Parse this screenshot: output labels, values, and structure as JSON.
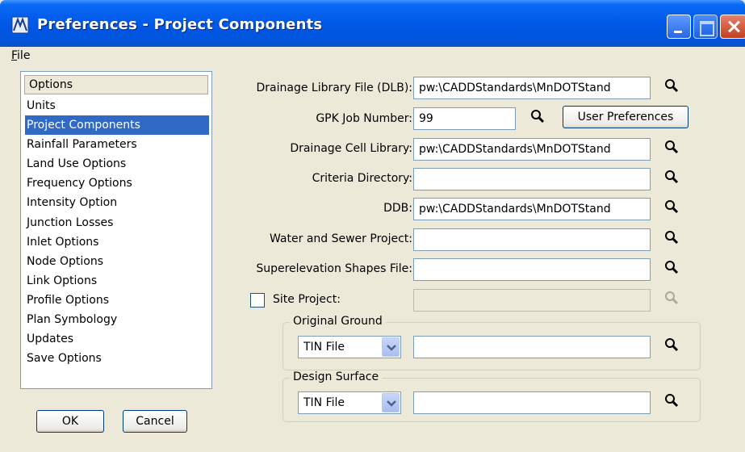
{
  "window": {
    "title": "Preferences - Project Components"
  },
  "menu": {
    "file_label": "File",
    "file_mnemonic": "F",
    "file_rest": "ile"
  },
  "options": {
    "header": "Options",
    "items": [
      "Units",
      "Project Components",
      "Rainfall Parameters",
      "Land Use Options",
      "Frequency Options",
      "Intensity Option",
      "Junction Losses",
      "Inlet Options",
      "Node Options",
      "Link Options",
      "Profile Options",
      "Plan Symbology",
      "Updates",
      "Save Options"
    ],
    "selected": "Project Components"
  },
  "buttons": {
    "ok": "OK",
    "cancel": "Cancel",
    "user_preferences": "User Preferences"
  },
  "form": {
    "drainage_library": {
      "label": "Drainage Library File (DLB):",
      "value": "pw:\\CADDStandards\\MnDOTStand"
    },
    "gpk_job": {
      "label": "GPK Job Number:",
      "value": "99"
    },
    "drainage_cell": {
      "label": "Drainage Cell Library:",
      "value": "pw:\\CADDStandards\\MnDOTStand"
    },
    "criteria_dir": {
      "label": "Criteria Directory:",
      "value": ""
    },
    "ddb": {
      "label": "DDB:",
      "value": "pw:\\CADDStandards\\MnDOTStand"
    },
    "water_sewer": {
      "label": "Water and Sewer Project:",
      "value": ""
    },
    "superelevation": {
      "label": "Superelevation Shapes File:",
      "value": ""
    },
    "site_project": {
      "label": "Site Project:",
      "checked": false,
      "value": ""
    }
  },
  "original_ground": {
    "title": "Original Ground",
    "type": "TIN File",
    "value": ""
  },
  "design_surface": {
    "title": "Design Surface",
    "type": "TIN File",
    "value": ""
  },
  "colors": {
    "selection": "#316AC5",
    "titlebar": "#0058E6",
    "dialog_bg": "#ECE9D8"
  }
}
